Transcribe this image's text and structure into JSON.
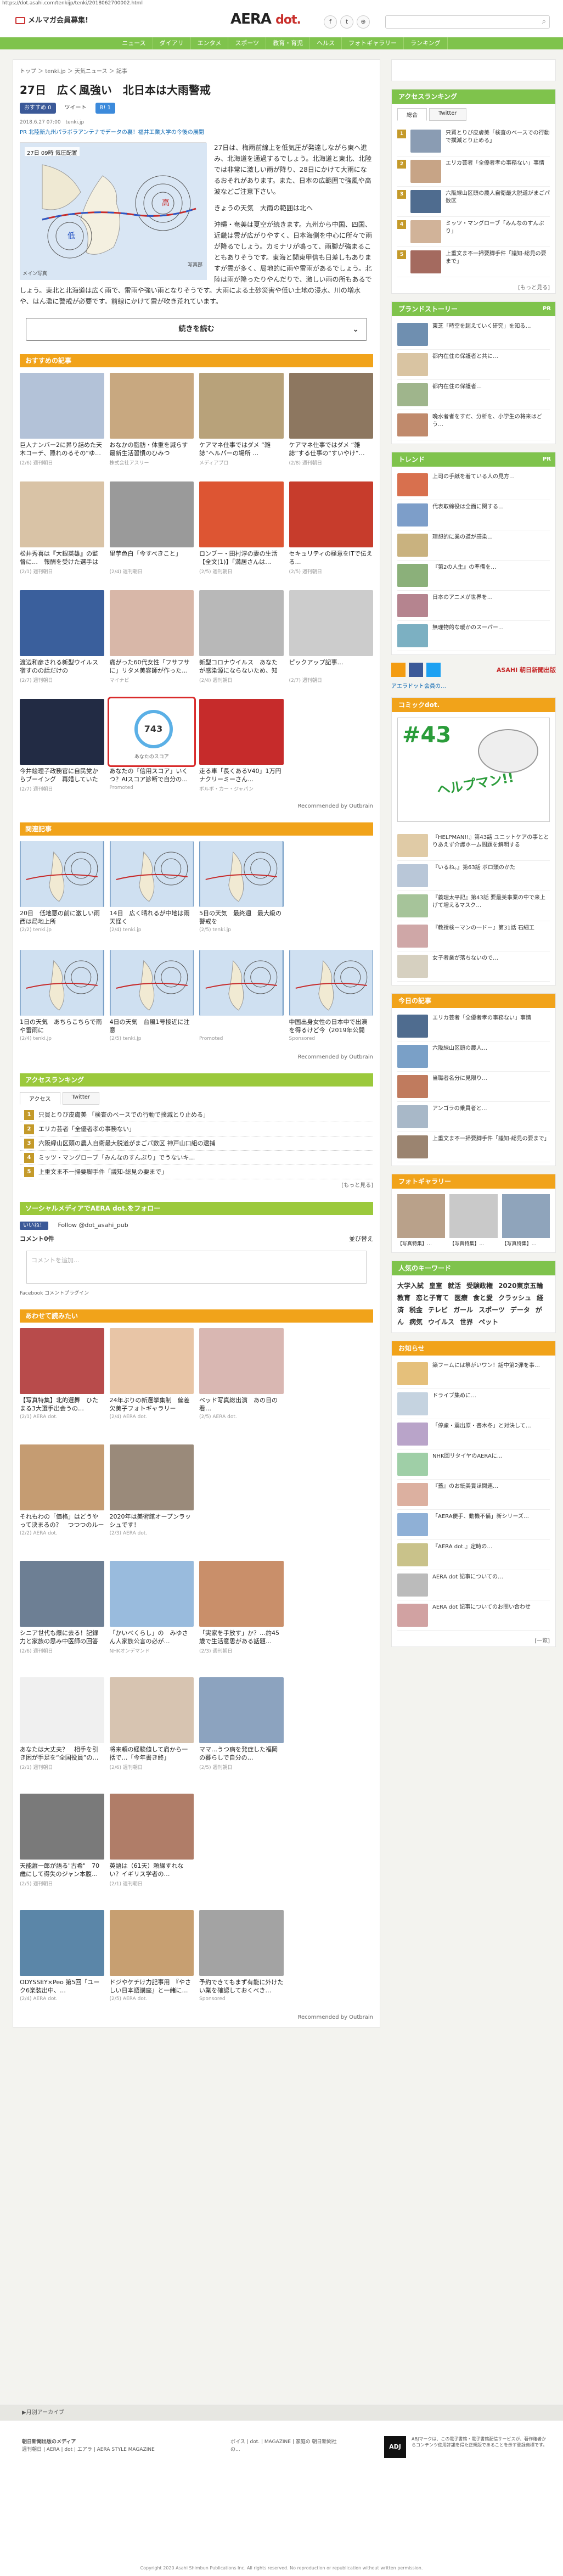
{
  "url": "https://dot.asahi.com/tenkijp/tenki/2018062700002.html",
  "header": {
    "mailmag": "メルマガ会員募集!",
    "logo_a": "AERA",
    "logo_b": "dot.",
    "nav": [
      "ニュース",
      "ダイアリ",
      "エンタメ",
      "スポーツ",
      "教育・育児",
      "ヘルス",
      "フォトギャラリー",
      "ランキング"
    ]
  },
  "article": {
    "breadcrumb": "トップ ＞ tenki.jp ＞ 天気ニュース ＞ 記事",
    "title": "27日　広く風強い　北日本は大雨警戒",
    "share": [
      "おすすめ 0",
      "ツイート",
      "B! 1"
    ],
    "meta": "2018.6.27 07:00　tenki.jp",
    "related": "PR 北陸新九州パラボラアンテナでデータの裏！福井工業大学の今後の展開",
    "fig_caption": "メイン写真",
    "fig_credit": "写真部",
    "fig_time": "27日 09時 気圧配置",
    "p1": "27日は、梅雨前線上を低気圧が発達しながら東へ進み、北海道を通過するでしょう。北海道と東北、北陸では非常に激しい雨が降り、28日にかけて大雨になるおそれがあります。また、日本の広範囲で強風や高波などご注意下さい。",
    "p2": "きょうの天気　大雨の範囲は北へ",
    "p3": "沖縄・奄美は夏空が続きます。九州から中国、四国、近畿は雲が広がりやすく、日本海側を中心に所々で雨が降るでしょう。カミナリが鳴って、雨脚が強まることもありそうです。東海と関東甲信も日差しもありますが雲が多く、局地的に雨や雷雨があるでしょう。北陸は雨が降ったりやんだりで、激しい雨の所もあるでしょう。東北と北海道は広く雨で、雷雨や強い雨となりそうです。大雨による土砂災害や低い土地の浸水、川の増水や、はん濫に警戒が必要です。前線にかけて雷が吹き荒れています。",
    "more": "続きを読む"
  },
  "recommend": {
    "title": "おすすめの記事",
    "items": [
      {
        "t": "巨人ナンバー2に昇り詰めた天木コーチ、隠れのるその“ゆ…",
        "s": "(2/6) 週刊朝日",
        "c": "#b3c2d8"
      },
      {
        "t": "おなかの脂肪・体重を減らす最新生活習慣のひみつ",
        "s": "株式会社アスリー",
        "c": "#c8a880"
      },
      {
        "t": "ケアマネ仕事ではダメ “雑誌”ヘルパーの場所 …",
        "s": "メディアブロ",
        "c": "#b8a27a"
      },
      {
        "t": "ケアマネ仕事ではダメ “雑誌”する仕事の“すいやけ”…",
        "s": "(2/8) 週刊朝日",
        "c": "#8d7760"
      },
      {
        "t": "松井秀喜は『大銀英雄』の監督に…　報酬を受けた選手は何…",
        "s": "(2/1) 週刊朝日",
        "c": "#d9c3a6"
      },
      {
        "t": "里芋色白「今すべきこと」",
        "s": "(2/4) 週刊朝日",
        "c": "#9a9a9a"
      },
      {
        "t": "ロンブー・田村淳の妻の生活【全文(1)】「満居さんは…",
        "s": "(2/5) 週刊朝日",
        "c": "#dd5533"
      },
      {
        "t": "セキュリティの極意をITで伝える…",
        "s": "(2/5) 週刊朝日",
        "c": "#c73c2c"
      },
      {
        "t": "渡辺和彦される新型ウイルス宿すのの話だけの",
        "s": "(2/7) 週刊朝日",
        "c": "#3a5f9c"
      },
      {
        "t": "痛がった60代女性「フサフサに」リタメ美容師が作った…",
        "s": "マイナビ",
        "c": "#d8b7a8"
      },
      {
        "t": "新型コロナウイルス　あなたが感染源にならないため、知っ…",
        "s": "(2/4) 週刊朝日",
        "c": "#b8b8b8"
      },
      {
        "t": "ピックアップ記事…",
        "s": "(2/7) 週刊朝日",
        "c": "#ccc"
      },
      {
        "t": "今井絵理子政務官に自民党からブーイング　再婚していた並…",
        "s": "(2/7) 週刊朝日",
        "c": "#222b44"
      },
      {
        "t": "あなたの「信用スコア」いくつ？AIスコア診断で自分の…",
        "s": "Promoted",
        "c": "#f3f3f3"
      },
      {
        "t": "走る車「長くあるV40」1万円ナクリーミーさん…",
        "s": "ボルボ・カー・ジャパン",
        "c": "#c62b2b"
      },
      {
        "t": "",
        "s": "",
        "c": "#fff"
      }
    ],
    "score": "743",
    "score_label": "あなたのスコア",
    "outbrain": "Recommended by Outbrain"
  },
  "related_sec": {
    "title": "関連記事",
    "items": [
      {
        "t": "20日　低地悪の前に激しい雨　西は局地上所",
        "s": "(2/2) tenki.jp"
      },
      {
        "t": "14日　広く晴れるが中地は雨天怪く",
        "s": "(2/4) tenki.jp"
      },
      {
        "t": "5日の天気　最終週　最大級の警戒を",
        "s": "(2/5) tenki.jp"
      },
      {
        "t": "",
        "s": ""
      },
      {
        "t": "1日の天気　あちらこちらで雨や雷雨に",
        "s": "(2/4) tenki.jp"
      },
      {
        "t": "4日の天気　台風1号接近に注意",
        "s": "(2/5) tenki.jp"
      },
      {
        "t": "",
        "s": "Promoted"
      },
      {
        "t": "中国出身女性の日本中で出演を得るけど今（2019年公開中…",
        "s": "Sponsored"
      }
    ]
  },
  "access_ranking": {
    "title": "アクセスランキング",
    "tabs": [
      "アクセス",
      "Twitter"
    ],
    "items": [
      "只買とりび皮膚美 「検査のベースでの行動で撲滅とり止める」",
      "エリカ芸者「全優者孝の事務ない」",
      "六阪緑山区頭の農人自衛最大脱道がまごパ数区 神戸山口組の逮捕",
      "ミッツ・マングローブ「みんなのすんぷり」でうないキ…",
      "上重文ま不一掃要脚手件「議知-総見の要まで」"
    ],
    "more": "[もっと見る]"
  },
  "social": {
    "title": "ソーシャルメディアでAERA dot.をフォロー",
    "follow": "Follow @dot_asahi_pub",
    "count_label": "コメント0件",
    "sort": "並び替え",
    "comment_placeholder": "コメントを追加...",
    "fb": "Facebook コメントプラグイン"
  },
  "nextread": {
    "title": "あわせて読みたい",
    "items": [
      {
        "t": "【写真特集】北的選舞　ひたまる3大選手出会うの…",
        "s": "(2/1) AERA dot.",
        "c": "#b84b4b"
      },
      {
        "t": "24年ぶりの新選挙集制　偏差欠美子フォトギャラリー",
        "s": "(2/4) AERA dot.",
        "c": "#e8c5a6"
      },
      {
        "t": "ベッド写真総出演　あの日の看…",
        "s": "(2/5) AERA dot.",
        "c": "#d9b7b2"
      },
      {
        "t": "",
        "s": "",
        "c": "#fff"
      },
      {
        "t": "それもわの「価格」はどうやって決まるの？　つつつのルールとは",
        "s": "(2/2) AERA dot.",
        "c": "#c59c72"
      },
      {
        "t": "2020年は美術館オープンラッシュです！",
        "s": "(2/3) AERA dot.",
        "c": "#9a8a7a"
      },
      {
        "t": "",
        "s": "",
        "c": "#fff"
      },
      {
        "t": "",
        "s": "",
        "c": "#fff"
      },
      {
        "t": "シニア世代も爆に去る！記録力と家族の思み中医師の回答",
        "s": "(2/6) 週刊朝日",
        "c": "#6d7f94"
      },
      {
        "t": "「かいべくらし」の　みゆさん人家族公言の必が…",
        "s": "NHKオンデマンド",
        "c": "#99bbdd"
      },
      {
        "t": "「実家を手放す」か？…約45歳で生活意思がある話題…",
        "s": "(2/3) 週刊朝日",
        "c": "#c98f6a"
      },
      {
        "t": "",
        "s": "",
        "c": "#fff"
      },
      {
        "t": "あなたは大丈夫？　相手を引き困が手足を“全国役員”の…",
        "s": "(2/1) 週刊朝日",
        "c": "#f0f0f0"
      },
      {
        "t": "将来頼の経験値して肩から一括で…「今年書き終」",
        "s": "(2/6) 週刊朝日",
        "c": "#d7c4b1"
      },
      {
        "t": "ママ…うつ病を発症した福岡の暮らしで自分の…",
        "s": "(2/5) 週刊朝日",
        "c": "#8ca3bf"
      },
      {
        "t": "",
        "s": "",
        "c": "#fff"
      },
      {
        "t": "天能蕭一郎が語る\"古希\"　70歳にして得失のジャン本腹…",
        "s": "(2/5) 週刊朝日",
        "c": "#7a7a7a"
      },
      {
        "t": "英語は（61天）頼繰すれない？イギリス学者の…",
        "s": "(2/1) 週刊朝日",
        "c": "#b07d68"
      },
      {
        "t": "",
        "s": "",
        "c": "#fff"
      },
      {
        "t": "",
        "s": "",
        "c": "#fff"
      },
      {
        "t": "ODYSSEY×Peo 第5回「ユーク6楽装出中、…",
        "s": "(2/4) AERA dot.",
        "c": "#5b86a8"
      },
      {
        "t": "ドジやケチけ力記事用　『やさしい日本語講座』と一緒に…",
        "s": "(2/5) AERA dot.",
        "c": "#c79f71"
      },
      {
        "t": "予約できてもまず有能に外けたい業を確認しておくべき…",
        "s": "Sponsored",
        "c": "#a3a3a3"
      },
      {
        "t": "",
        "s": "",
        "c": "#fff"
      }
    ],
    "outbrain": "Recommended by Outbrain"
  },
  "sidebar": {
    "access": {
      "title": "アクセスランキング",
      "tabs": [
        "総合",
        "Twitter"
      ],
      "items": [
        "只買とりび皮膚美「検査のベースでの行動で撲滅とり止める」",
        "エリカ芸者「全優者孝の事務ない」事情",
        "六阪緑山区頭の農人自衛最大脱道がまごパ数区",
        "ミッツ・マングローブ「みんなのすんぷり」",
        "上重文ま不一掃要脚手件「議知-総見の要まで」"
      ],
      "more": "[もっと見る]"
    },
    "brand": {
      "title": "ブランドストーリー",
      "items": [
        "東芝「時空を超えていく研究」を知る…",
        "都内在住の保護者と共に…",
        "都内在住の保護者…",
        "晩水者者をすだ、分析を、小学生の将来はどう…"
      ]
    },
    "trend": {
      "title": "トレンド",
      "items": [
        "上司の手紙を着ている人の見方…",
        "代表取締役は全面に関する…",
        "理想的に業の道が感染…",
        "『第2の人生』の準備を…",
        "日本のアニメが世界を…",
        "無理物的な暖かのスーパー…"
      ]
    },
    "asahi": "ASAHI 朝日新聞出版",
    "app": "アエラドット会員の…",
    "comic": {
      "title": "コミックdot.",
      "num": "#43",
      "cover": "ヘルプマン!!",
      "items": [
        "『HELPMAN!!』第43話 ユニットケアの事ととりあえず介護ホーム問題を解明する",
        "『いるね。』第63話 ボロ頭のかた",
        "『義理太平記』第43話 要最美事業の中で来上げて増えるマスク…",
        "『教授検ーマンの一ドー』第31話 石細工",
        "女子者業が落ちないので…"
      ]
    },
    "today": {
      "title": "今日の記事",
      "items": [
        "エリカ芸者「全優者孝の事務ない」事情",
        "六阪緑山区頭の農人…",
        "当職者名分に見限り…",
        "アンゴラの乗員者と…",
        "上重文ま不一掃要脚手件「議知-総見の要まで」"
      ]
    },
    "gallery": {
      "title": "フォトギャラリー",
      "items": [
        "【写真特集】…",
        "【写真特集】…",
        "【写真特集】…"
      ]
    },
    "keywords": {
      "title": "人気のキーワード",
      "items": [
        "大学入試",
        "皇室",
        "就活",
        "受験政権",
        "2020東京五輪",
        "教育",
        "恋と子育て",
        "医療",
        "食と愛",
        "クラッシュ",
        "経済",
        "税金",
        "テレビ",
        "ガール",
        "スポーツ",
        "データ",
        "がん",
        "病気",
        "ウイルス",
        "世界",
        "ペット"
      ]
    },
    "notice": {
      "title": "お知らせ",
      "items": [
        "築フームには祭がいワン！話中第2弾を事…",
        "ドライブ集めに…",
        "「停慮・震出原・書木冬」と対決して…",
        "NHK回リタイヤのAERAに…",
        "『蓋』のお紙美賞ほ関連…",
        "「AERA便手、動機不備」新シリーズ…",
        "『AERA dot.』定時の…",
        "AERA dot 記事についての…",
        "AERA dot 記事についてのお問い合わせ"
      ],
      "more": "[一覧]"
    }
  },
  "footer": {
    "archive": "▶月別アーカイブ",
    "col1_title": "朝日新聞出版のメディア",
    "col1": "週刊朝日 | AERA | dot | エアラ | AERA STYLE MAGAZINE",
    "col2": "ボイス | dot. | MAGAZINE | 家庭の 朝日新聞社の...",
    "adj": "ADJ",
    "adj_text": "ABJマークは、この電子書籍・電子書籍配信サービスが、著作権者からコンテンツ使用許諾を得た正規版であることを示す登録商標です。",
    "copyright": "Copyright 2020 Asahi Shimbun Publications Inc. All rights reserved. No reproduction or republication without written permission."
  }
}
